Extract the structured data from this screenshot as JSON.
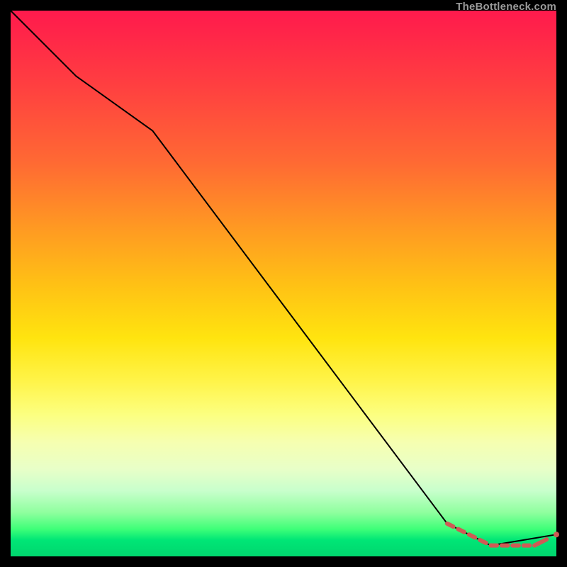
{
  "watermark": "TheBottleneck.com",
  "colors": {
    "line": "#000000",
    "dash": "#cf5a55",
    "page_bg": "#000000"
  },
  "chart_data": {
    "type": "line",
    "title": "",
    "xlabel": "",
    "ylabel": "",
    "xlim": [
      0,
      100
    ],
    "ylim": [
      0,
      100
    ],
    "grid": false,
    "legend": false,
    "series": [
      {
        "name": "bottleneck-curve",
        "style": "solid",
        "color": "#000000",
        "x": [
          0,
          12,
          26,
          80,
          88,
          100
        ],
        "y": [
          100,
          88,
          78,
          6,
          2,
          4
        ]
      },
      {
        "name": "highlight-tail",
        "style": "dashed-with-dots",
        "color": "#cf5a55",
        "x": [
          80,
          82,
          84,
          86,
          88,
          90,
          92,
          94,
          96,
          100
        ],
        "y": [
          6,
          5,
          4,
          3,
          2,
          2,
          2,
          2,
          2,
          4
        ]
      }
    ],
    "notes": "No axis ticks or numeric labels are rendered; values are estimated from relative pixel positions on a 0–100 normalized scale."
  }
}
